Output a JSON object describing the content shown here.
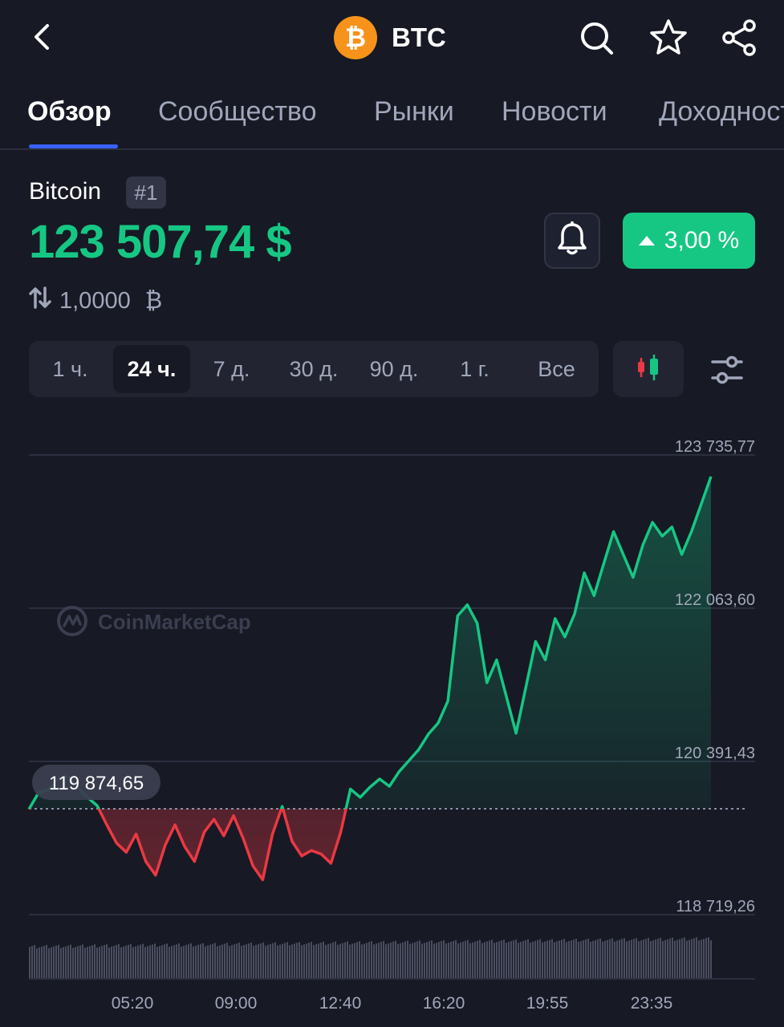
{
  "header": {
    "coin_symbol": "BTC",
    "coin_logo_glyph": "₿",
    "icons": [
      "back-chevron-icon",
      "search-icon",
      "star-icon",
      "share-icon"
    ]
  },
  "tabs": [
    {
      "label": "Обзор",
      "active": true
    },
    {
      "label": "Сообщество",
      "active": false
    },
    {
      "label": "Рынки",
      "active": false
    },
    {
      "label": "Новости",
      "active": false
    },
    {
      "label": "Доходность",
      "active": false
    }
  ],
  "coin": {
    "name": "Bitcoin",
    "rank": "#1",
    "price": "123 507,74 $",
    "change": "3,00 %",
    "convert_value": "1,0000",
    "convert_unit": "₿"
  },
  "colors": {
    "up": "#16c784",
    "down": "#ea3943",
    "accent": "#3861fb",
    "bitcoin": "#f7931a"
  },
  "ranges": [
    {
      "label": "1 ч.",
      "active": false
    },
    {
      "label": "24 ч.",
      "active": true
    },
    {
      "label": "7 д.",
      "active": false
    },
    {
      "label": "30 д.",
      "active": false
    },
    {
      "label": "90 д.",
      "active": false
    },
    {
      "label": "1 г.",
      "active": false
    },
    {
      "label": "Все",
      "active": false
    }
  ],
  "watermark": "CoinMarketCap",
  "chart_data": {
    "type": "line",
    "y_tick_labels": [
      "123 735,77",
      "122 063,60",
      "120 391,43",
      "118 719,26"
    ],
    "y_ticks": [
      123735.77,
      122063.6,
      120391.43,
      118719.26
    ],
    "ylim": [
      118719.26,
      123735.77
    ],
    "baseline_label": "119 874,65",
    "baseline": 119874.65,
    "x_tick_labels": [
      "05:20",
      "09:00",
      "12:40",
      "16:20",
      "19:55",
      "23:35"
    ],
    "grid": true,
    "series": [
      {
        "values": [
          119870,
          120050,
          120080,
          120200,
          120230,
          120110,
          120000,
          119910,
          119700,
          119500,
          119400,
          119600,
          119300,
          119150,
          119480,
          119700,
          119460,
          119300,
          119620,
          119760,
          119580,
          119800,
          119550,
          119250,
          119100,
          119600,
          119900,
          119520,
          119360,
          119420,
          119380,
          119280,
          119620,
          120090,
          120000,
          120110,
          120200,
          120120,
          120280,
          120400,
          120520,
          120690,
          120810,
          121050,
          121980,
          122100,
          121900,
          121250,
          121500,
          121100,
          120700,
          121200,
          121700,
          121500,
          121950,
          121750,
          122000,
          122450,
          122200,
          122550,
          122900,
          122650,
          122400,
          122750,
          123000,
          122850,
          122950,
          122650,
          122900,
          123200,
          123500
        ],
        "red_below_baseline": true
      }
    ],
    "volume": {
      "shown": true
    }
  }
}
